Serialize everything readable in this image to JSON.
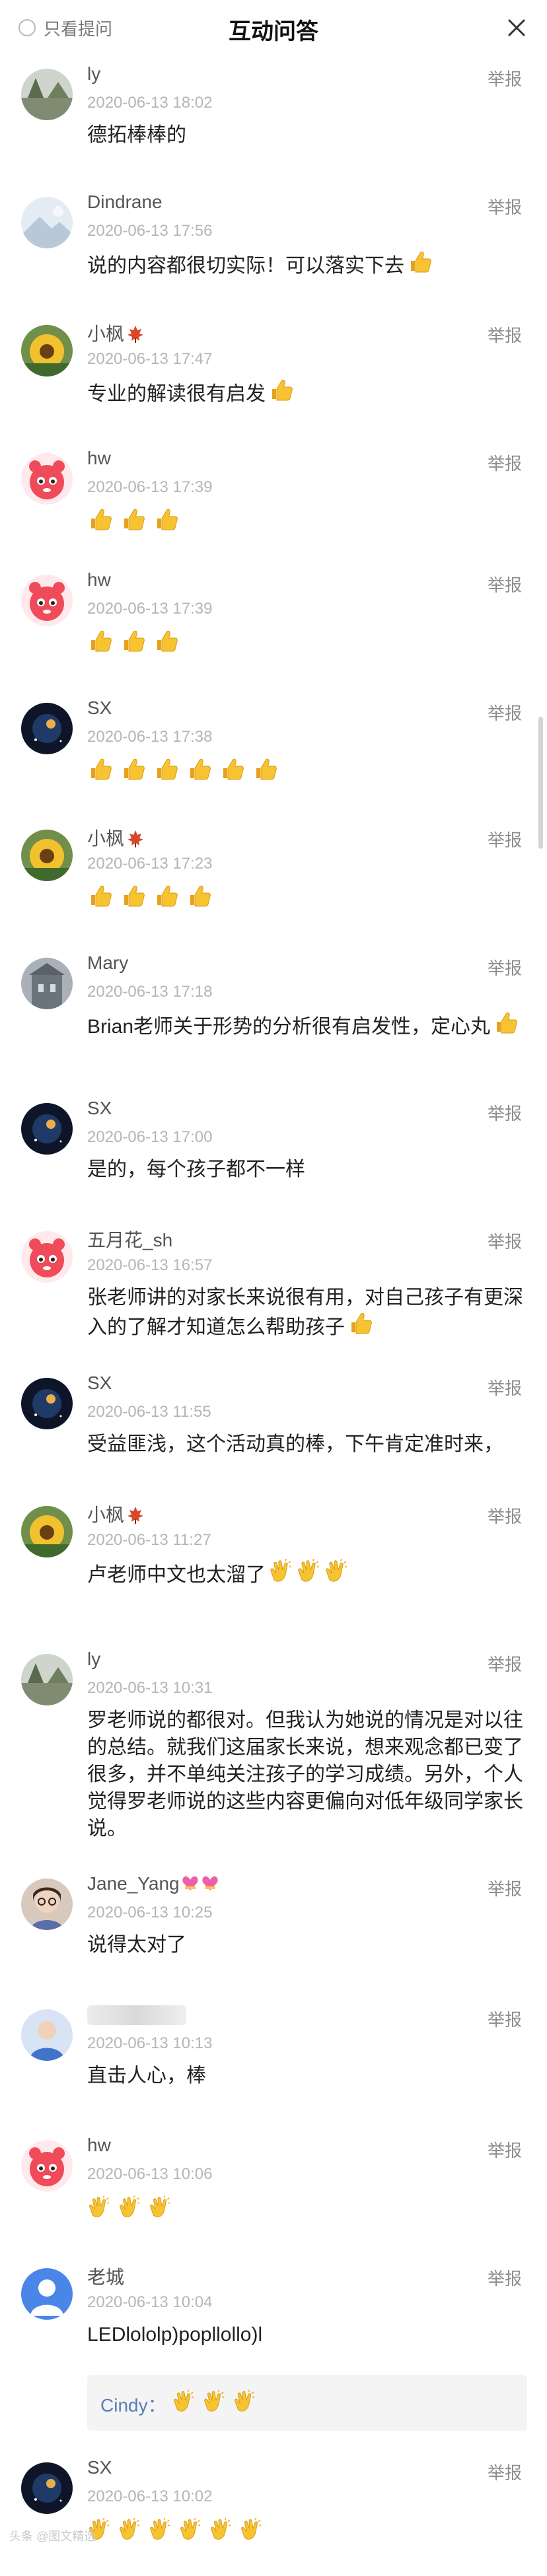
{
  "header": {
    "only_ask_label": "只看提问",
    "title": "互动问答"
  },
  "report_label": "举报",
  "comments": [
    {
      "name": "ly",
      "time": "2020-06-13 18:02",
      "text": "德拓棒棒的",
      "avatar": "landscape-gray"
    },
    {
      "name": "Dindrane",
      "time": "2020-06-13 17:56",
      "text": "说的内容都很切实际！可以落实下去",
      "emoji": "thumbs-up",
      "avatar": "mountain-light"
    },
    {
      "name": "小枫",
      "name_emoji": "maple-leaf",
      "time": "2020-06-13 17:47",
      "text": "专业的解读很有启发",
      "emoji": "thumbs-up",
      "avatar": "sunflower"
    },
    {
      "name": "hw",
      "time": "2020-06-13 17:39",
      "thumbs": 3,
      "avatar": "red-cartoon"
    },
    {
      "name": "hw",
      "time": "2020-06-13 17:39",
      "thumbs": 3,
      "avatar": "red-cartoon"
    },
    {
      "name": "SX",
      "time": "2020-06-13 17:38",
      "thumbs": 6,
      "avatar": "dark-galaxy"
    },
    {
      "name": "小枫",
      "name_emoji": "maple-leaf",
      "time": "2020-06-13 17:23",
      "thumbs": 4,
      "avatar": "sunflower"
    },
    {
      "name": "Mary",
      "time": "2020-06-13 17:18",
      "text": "Brian老师关于形势的分析很有启发性，定心丸",
      "emoji": "thumbs-up",
      "avatar": "building-gray"
    },
    {
      "name": "SX",
      "time": "2020-06-13 17:00",
      "text": "是的，每个孩子都不一样",
      "avatar": "dark-galaxy"
    },
    {
      "name": "五月花_sh",
      "time": "2020-06-13 16:57",
      "text": "张老师讲的对家长来说很有用，对自己孩子有更深入的了解才知道怎么帮助孩子",
      "emoji": "thumbs-up",
      "avatar": "red-cartoon"
    },
    {
      "name": "SX",
      "time": "2020-06-13 11:55",
      "text": "受益匪浅，这个活动真的棒，下午肯定准时来，",
      "avatar": "dark-galaxy"
    },
    {
      "name": "小枫",
      "name_emoji": "maple-leaf",
      "time": "2020-06-13 11:27",
      "text": "卢老师中文也太溜了",
      "claps_inline": 3,
      "avatar": "sunflower"
    },
    {
      "name": "ly",
      "time": "2020-06-13 10:31",
      "text": "罗老师说的都很对。但我认为她说的情况是对以往的总结。就我们这届家长来说，想来观念都已变了很多，并不单纯关注孩子的学习成绩。另外，个人觉得罗老师说的这些内容更偏向对低年级同学家长说。",
      "avatar": "landscape-gray"
    },
    {
      "name": "Jane_Yang",
      "name_emoji": "hearts",
      "time": "2020-06-13 10:25",
      "text": "说得太对了",
      "avatar": "woman-glasses"
    },
    {
      "name": "",
      "time": "2020-06-13 10:13",
      "text": "直击人心，棒",
      "avatar": "photo-blue"
    },
    {
      "name": "hw",
      "time": "2020-06-13 10:06",
      "claps": 3,
      "avatar": "red-cartoon"
    },
    {
      "name": "老城",
      "time": "2020-06-13 10:04",
      "text": "LEDlololp)popllollo)l",
      "reply": {
        "name": "Cindy：",
        "claps": 3
      },
      "avatar": "default-blue"
    },
    {
      "name": "SX",
      "time": "2020-06-13 10:02",
      "claps": 6,
      "avatar": "dark-galaxy"
    }
  ],
  "watermark": "头条 @图文精选"
}
